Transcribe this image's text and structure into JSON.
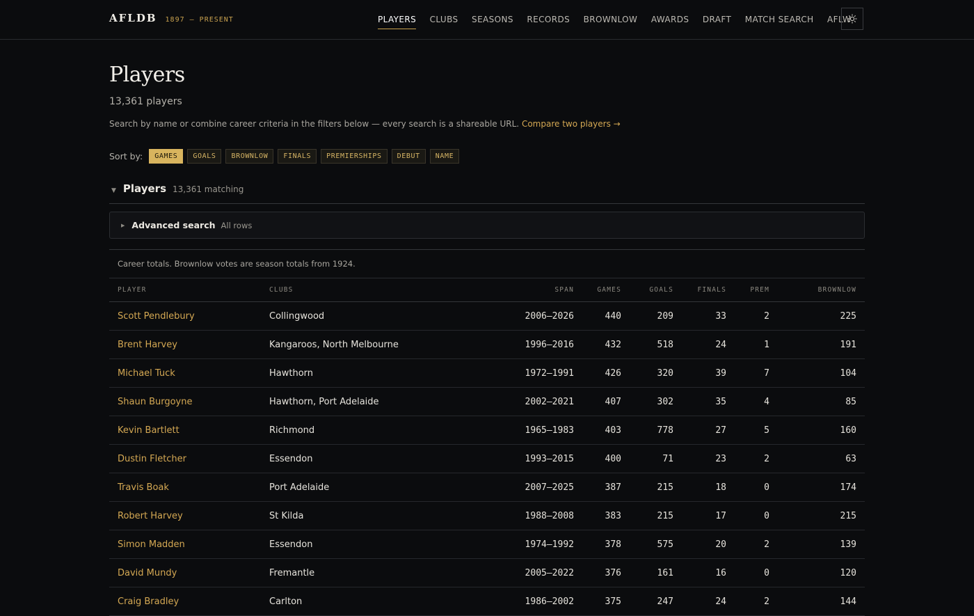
{
  "brand": {
    "name": "AFLDB",
    "sub": "1897 — PRESENT"
  },
  "nav": [
    {
      "label": "PLAYERS",
      "active": true
    },
    {
      "label": "CLUBS"
    },
    {
      "label": "SEASONS"
    },
    {
      "label": "RECORDS"
    },
    {
      "label": "BROWNLOW"
    },
    {
      "label": "AWARDS"
    },
    {
      "label": "DRAFT"
    },
    {
      "label": "MATCH SEARCH"
    },
    {
      "label": "AFLW"
    }
  ],
  "theme_toggle_icon": "sun-icon",
  "page": {
    "title": "Players",
    "count": "13,361 players",
    "description": "Search by name or combine career criteria in the filters below — every search is a shareable URL.",
    "compare_link": "Compare two players →"
  },
  "sort": {
    "label": "Sort by:",
    "options": [
      "GAMES",
      "GOALS",
      "BROWNLOW",
      "FINALS",
      "PREMIERSHIPS",
      "DEBUT",
      "NAME"
    ],
    "active": "GAMES"
  },
  "section": {
    "title": "Players",
    "count": "13,361 matching"
  },
  "advanced": {
    "title": "Advanced search",
    "sub": "All rows"
  },
  "table": {
    "note": "Career totals. Brownlow votes are season totals from 1924.",
    "columns": [
      "PLAYER",
      "CLUBS",
      "SPAN",
      "GAMES",
      "GOALS",
      "FINALS",
      "PREM",
      "BROWNLOW"
    ],
    "rows": [
      [
        "Scott Pendlebury",
        "Collingwood",
        "2006–2026",
        "440",
        "209",
        "33",
        "2",
        "225"
      ],
      [
        "Brent Harvey",
        "Kangaroos, North Melbourne",
        "1996–2016",
        "432",
        "518",
        "24",
        "1",
        "191"
      ],
      [
        "Michael Tuck",
        "Hawthorn",
        "1972–1991",
        "426",
        "320",
        "39",
        "7",
        "104"
      ],
      [
        "Shaun Burgoyne",
        "Hawthorn, Port Adelaide",
        "2002–2021",
        "407",
        "302",
        "35",
        "4",
        "85"
      ],
      [
        "Kevin Bartlett",
        "Richmond",
        "1965–1983",
        "403",
        "778",
        "27",
        "5",
        "160"
      ],
      [
        "Dustin Fletcher",
        "Essendon",
        "1993–2015",
        "400",
        "71",
        "23",
        "2",
        "63"
      ],
      [
        "Travis Boak",
        "Port Adelaide",
        "2007–2025",
        "387",
        "215",
        "18",
        "0",
        "174"
      ],
      [
        "Robert Harvey",
        "St Kilda",
        "1988–2008",
        "383",
        "215",
        "17",
        "0",
        "215"
      ],
      [
        "Simon Madden",
        "Essendon",
        "1974–1992",
        "378",
        "575",
        "20",
        "2",
        "139"
      ],
      [
        "David Mundy",
        "Fremantle",
        "2005–2022",
        "376",
        "161",
        "16",
        "0",
        "120"
      ],
      [
        "Craig Bradley",
        "Carlton",
        "1986–2002",
        "375",
        "247",
        "24",
        "2",
        "144"
      ]
    ]
  }
}
